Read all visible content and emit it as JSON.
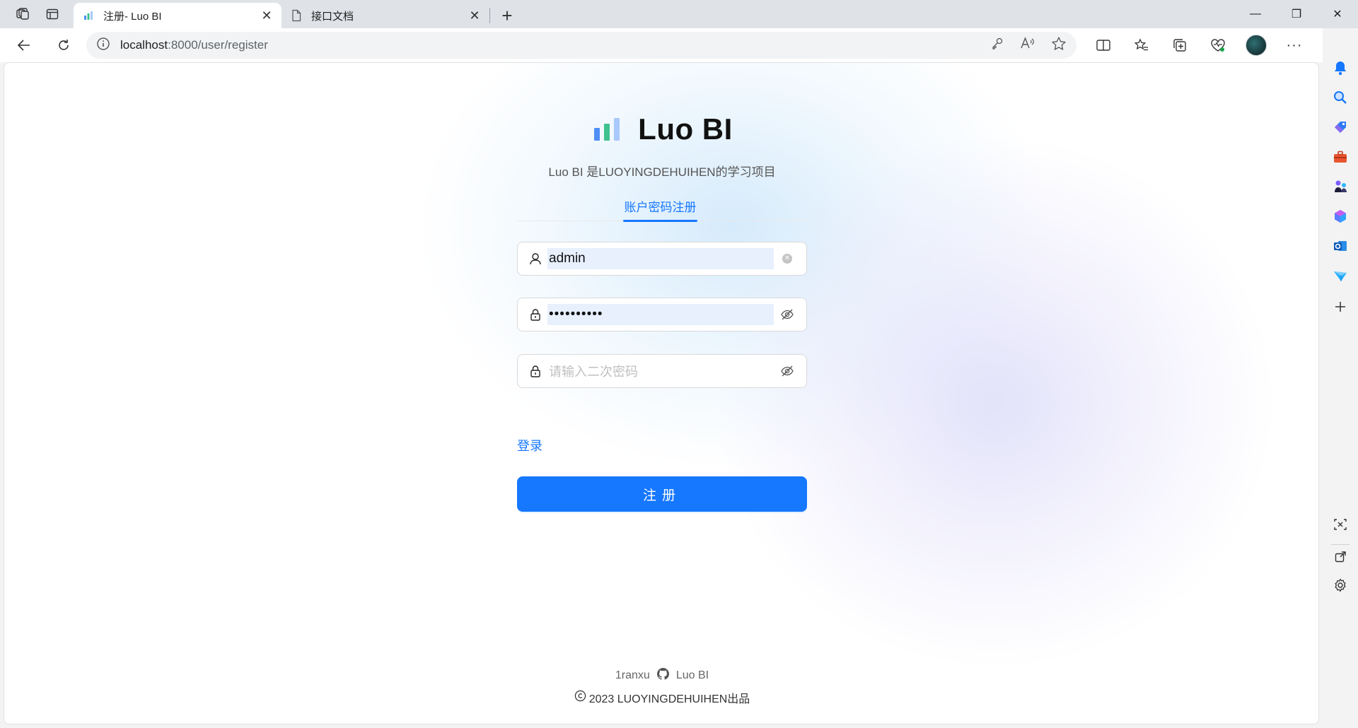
{
  "browser": {
    "tabs": [
      {
        "title": "注册- Luo BI",
        "active": true
      },
      {
        "title": "接口文档",
        "active": false
      }
    ],
    "url_host": "localhost",
    "url_path": ":8000/user/register"
  },
  "page": {
    "brand_name": "Luo BI",
    "tagline": "Luo BI 是LUOYINGDEHUIHEN的学习项目",
    "tab_label": "账户密码注册",
    "username_value": "admin",
    "password_value": "••••••••••",
    "confirm_placeholder": "请输入二次密码",
    "login_link": "登录",
    "submit_label": "注册",
    "footer": {
      "author": "1ranxu",
      "project": "Luo BI",
      "copyright": "2023 LUOYINGDEHUIHEN出品"
    }
  },
  "colors": {
    "primary": "#1677ff",
    "logo_bar1": "#4e8ef7",
    "logo_bar2": "#3ec28f",
    "logo_bar3": "#a9c8fb"
  },
  "icons": [
    "workspaces-icon",
    "tab-actions-icon",
    "back-icon",
    "refresh-icon",
    "info-icon",
    "key-icon",
    "read-aloud-icon",
    "favorite-star-icon",
    "split-screen-icon",
    "favorites-icon",
    "collections-icon",
    "browser-essentials-icon",
    "more-icon",
    "copilot-icon",
    "user-icon",
    "lock-icon",
    "eye-invisible-icon",
    "github-icon",
    "copyright-icon"
  ]
}
